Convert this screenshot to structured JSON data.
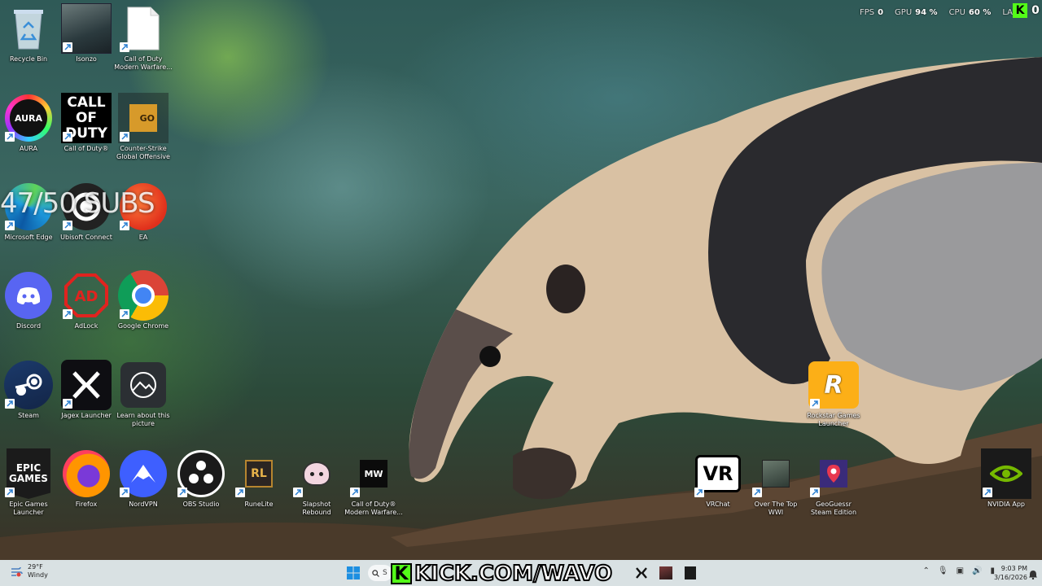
{
  "overlay": {
    "subs_text": "47/50 SUBS",
    "stats": [
      {
        "label": "FPS",
        "value": "0"
      },
      {
        "label": "GPU",
        "value": "94 %"
      },
      {
        "label": "CPU",
        "value": "60 %"
      },
      {
        "label": "LA",
        "value": ""
      }
    ],
    "kick_count": "0",
    "kick_letter": "K"
  },
  "desktop_icons": [
    {
      "label": "Recycle Bin",
      "icon": "recycle-bin-icon"
    },
    {
      "label": "Isonzo",
      "icon": "isonzo-icon"
    },
    {
      "label": "Call of Duty Modern Warfare...",
      "icon": "blank-file-icon"
    },
    {
      "label": "AURA",
      "icon": "aura-icon",
      "badge": "AURA"
    },
    {
      "label": "Call of Duty®",
      "icon": "call-of-duty-icon",
      "badge": "CALL OF DUTY"
    },
    {
      "label": "Counter-Strike Global Offensive",
      "icon": "csgo-icon",
      "badge": "GO"
    },
    {
      "label": "Microsoft Edge",
      "icon": "edge-icon"
    },
    {
      "label": "Ubisoft Connect",
      "icon": "ubisoft-icon"
    },
    {
      "label": "EA",
      "icon": "ea-icon"
    },
    {
      "label": "Discord",
      "icon": "discord-icon"
    },
    {
      "label": "AdLock",
      "icon": "adlock-icon",
      "badge": "AD"
    },
    {
      "label": "Google Chrome",
      "icon": "chrome-icon"
    },
    {
      "label": "Steam",
      "icon": "steam-icon"
    },
    {
      "label": "Jagex Launcher",
      "icon": "jagex-icon"
    },
    {
      "label": "Learn about this picture",
      "icon": "learn-picture-icon"
    },
    {
      "label": "Epic Games Launcher",
      "icon": "epic-games-icon",
      "badge": "EPIC GAMES"
    },
    {
      "label": "Firefox",
      "icon": "firefox-icon"
    },
    {
      "label": "NordVPN",
      "icon": "nordvpn-icon"
    },
    {
      "label": "OBS Studio",
      "icon": "obs-icon"
    },
    {
      "label": "RuneLite",
      "icon": "runelite-icon",
      "badge": "RL"
    },
    {
      "label": "Slapshot Rebound",
      "icon": "slapshot-icon"
    },
    {
      "label": "Call of Duty® Modern Warfare...",
      "icon": "mw-icon",
      "badge": "MW"
    },
    {
      "label": "Rockstar Games Launcher",
      "icon": "rockstar-icon",
      "badge": "R"
    },
    {
      "label": "VRChat",
      "icon": "vrchat-icon",
      "badge": "VR"
    },
    {
      "label": "Over The Top WWI",
      "icon": "over-the-top-icon"
    },
    {
      "label": "GeoGuessr Steam Edition",
      "icon": "geoguessr-icon"
    },
    {
      "label": "NVIDIA App",
      "icon": "nvidia-icon"
    }
  ],
  "taskbar": {
    "weather_temp": "29°F",
    "weather_desc": "Windy",
    "search_letter": "S",
    "kick_banner_text": "KICK.COM/WAVO",
    "time": "9:03 PM",
    "date": "3/16/2026"
  },
  "colors": {
    "kick_green": "#53fc18",
    "taskbar_bg": "#e1e8eb"
  }
}
